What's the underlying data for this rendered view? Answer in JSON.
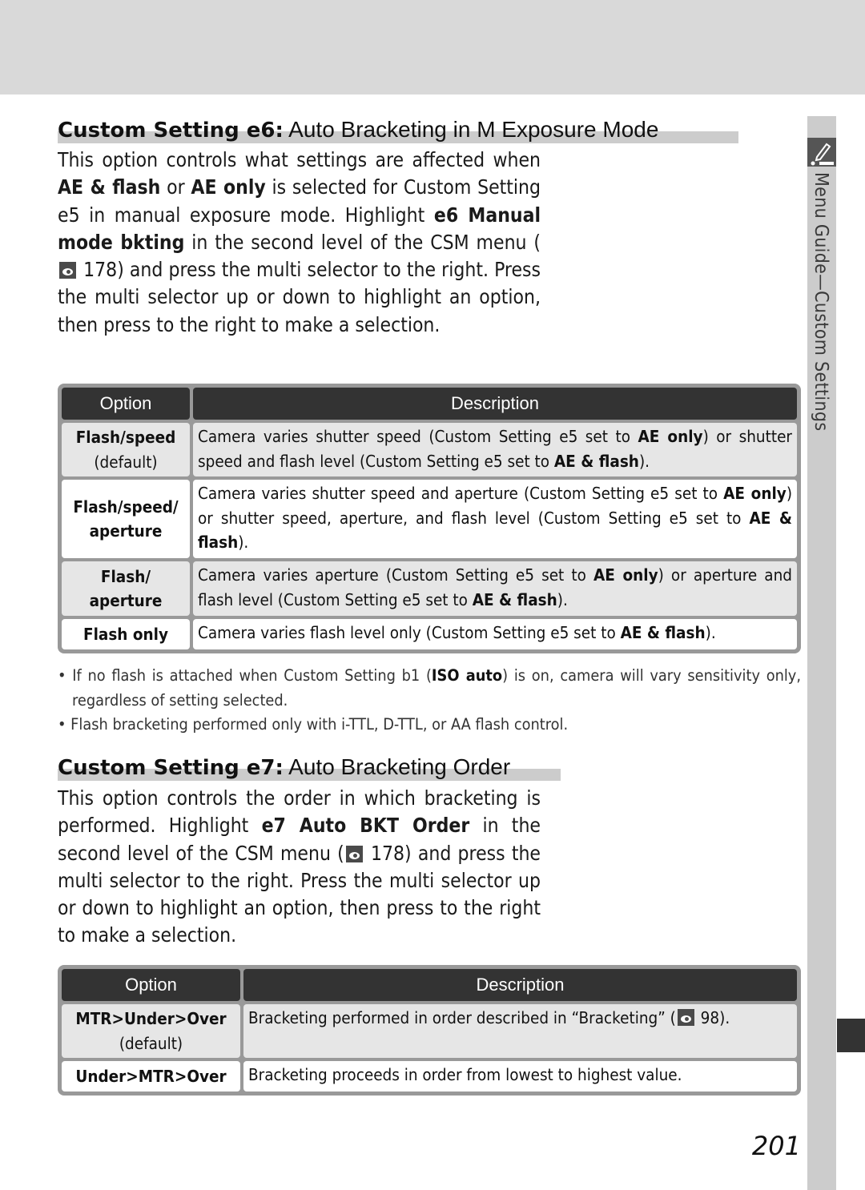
{
  "page": {
    "number": "201",
    "side_label": "Menu Guide—Custom Settings",
    "side_icon": "pencil-menu-icon",
    "ref_icon": "eye-reference-icon"
  },
  "section_e6": {
    "heading_bold": "Custom Setting e6:",
    "heading_rest": " Auto Bracketing in M Exposure Mode",
    "para": [
      {
        "t": "This option controls what settings are affected when "
      },
      {
        "b": "AE & flash"
      },
      {
        "t": " or "
      },
      {
        "b": "AE only"
      },
      {
        "t": " is selected for Custom Setting e5 in manual exposure mode. Highlight "
      },
      {
        "b": "e6 Manual mode bkting"
      },
      {
        "t": " in the sec­ond level of the CSM menu ("
      },
      {
        "icon": "eye-reference-icon"
      },
      {
        "t": " 178) and press the multi selector to the right.  Press the multi selector up or down to highlight an option, then press to the right to make a selection."
      }
    ],
    "table": {
      "headers": [
        "Option",
        "Description"
      ],
      "rows": [
        {
          "option": "Flash/speed",
          "option_sub": "(default)",
          "description": [
            {
              "t": "Camera varies shutter speed (Custom Setting e5 set to "
            },
            {
              "b": "AE only"
            },
            {
              "t": ") or shutter speed and flash level (Custom Setting e5 set to "
            },
            {
              "b": "AE & flash"
            },
            {
              "t": ")."
            }
          ]
        },
        {
          "option": "Flash/speed/ aperture",
          "option_sub": "",
          "description": [
            {
              "t": "Camera varies shutter speed and aperture (Custom Setting e5 set to "
            },
            {
              "b": "AE only"
            },
            {
              "t": ") or shutter speed, aperture, and flash level (Custom Setting e5 set to "
            },
            {
              "b": "AE & flash"
            },
            {
              "t": ")."
            }
          ]
        },
        {
          "option": "Flash/ aperture",
          "option_sub": "",
          "description": [
            {
              "t": "Camera varies aperture (Custom Setting e5 set to "
            },
            {
              "b": "AE only"
            },
            {
              "t": ") or aper­ture and flash level (Custom Setting e5 set to "
            },
            {
              "b": "AE & flash"
            },
            {
              "t": ")."
            }
          ]
        },
        {
          "option": "Flash only",
          "option_sub": "",
          "description": [
            {
              "t": "Camera varies flash level only (Custom Setting e5 set to "
            },
            {
              "b": "AE & flash"
            },
            {
              "t": ")."
            }
          ]
        }
      ]
    },
    "notes": [
      [
        {
          "t": "• If no flash is attached when Custom Setting b1 ("
        },
        {
          "b": "ISO auto"
        },
        {
          "t": ") is on, camera will vary sensitivity only, regardless of setting selected."
        }
      ],
      [
        {
          "t": "• Flash bracketing performed only with i-TTL, D-TTL, or AA flash control."
        }
      ]
    ]
  },
  "section_e7": {
    "heading_bold": "Custom Setting e7:",
    "heading_rest": " Auto Bracketing Order",
    "para": [
      {
        "t": "This option controls the order in which bracketing is performed.  Highlight "
      },
      {
        "b": "e7 Auto BKT Order"
      },
      {
        "t": " in the second level of the CSM menu ("
      },
      {
        "icon": "eye-reference-icon"
      },
      {
        "t": " 178) and press the multi selector to the right.  Press the multi selector up or down to highlight an option, then press to the right to make a selection."
      }
    ],
    "table": {
      "headers": [
        "Option",
        "Description"
      ],
      "rows": [
        {
          "option": "MTR>Under>Over",
          "option_sub": "(default)",
          "description": [
            {
              "t": "Bracketing performed in order described in “Bracketing” ("
            },
            {
              "icon": "eye-reference-icon"
            },
            {
              "t": " 98)."
            }
          ]
        },
        {
          "option": "Under>MTR>Over",
          "option_sub": "",
          "description": [
            {
              "t": "Bracketing proceeds in order from lowest to highest value."
            }
          ]
        }
      ]
    }
  }
}
